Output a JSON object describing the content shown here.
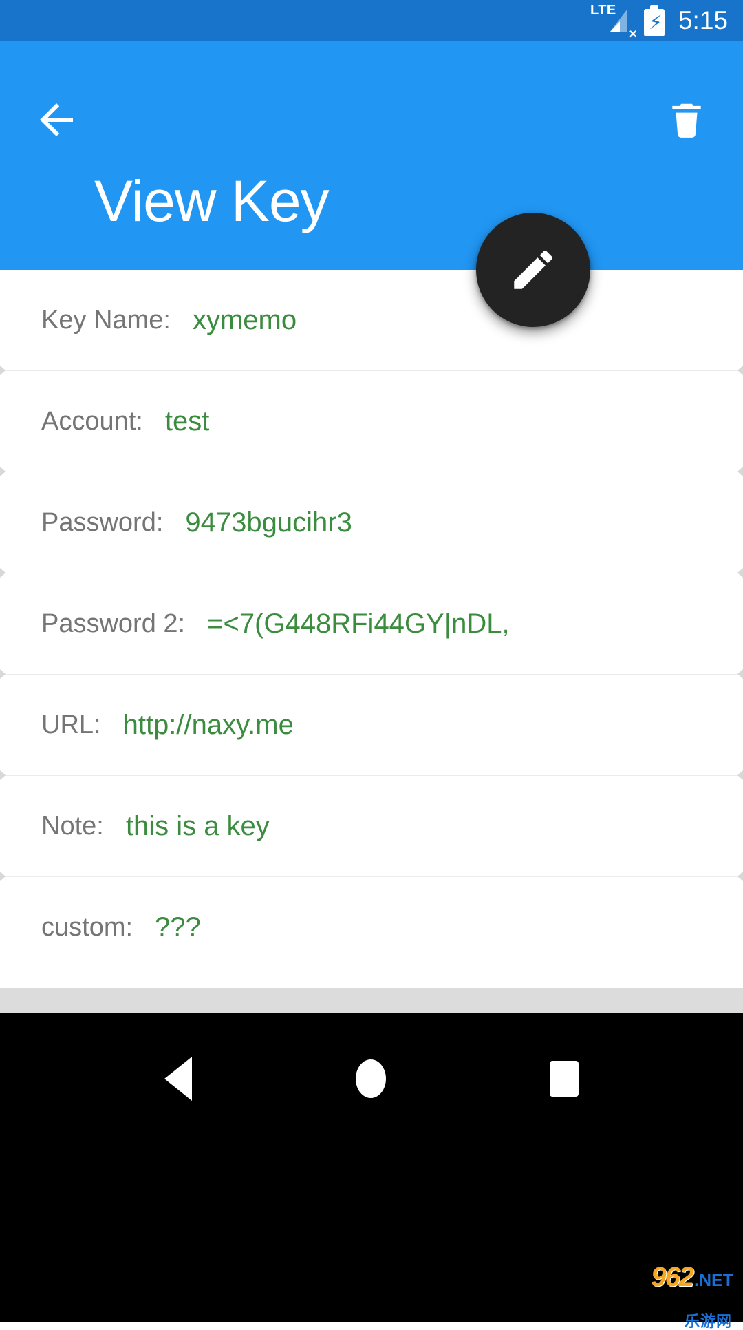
{
  "status_bar": {
    "network_label": "LTE",
    "no_signal_mark": "×",
    "battery_icon": "battery-charging-icon",
    "time": "5:15"
  },
  "app_bar": {
    "title": "View Key",
    "back_icon": "arrow-left-icon",
    "delete_icon": "trash-icon",
    "background_color": "#2196F3"
  },
  "fab": {
    "icon": "pencil-edit-icon",
    "background_color": "#232323",
    "icon_color": "#FFFFFF"
  },
  "colors": {
    "label": "#757575",
    "value": "#3B8C3F",
    "accent": "#2196F3",
    "status_bar": "#1874CB"
  },
  "fields": [
    {
      "label": "Key Name:",
      "value": "xymemo"
    },
    {
      "label": "Account:",
      "value": "test"
    },
    {
      "label": "Password:",
      "value": "9473bgucihr3"
    },
    {
      "label": "Password 2:",
      "value": "=<7(G448RFi44GY|nDL,"
    },
    {
      "label": "URL:",
      "value": "http://naxy.me"
    },
    {
      "label": "Note:",
      "value": "this is a key"
    },
    {
      "label": "custom:",
      "value": "???"
    }
  ],
  "nav_bar": {
    "back": "nav-back-triangle-icon",
    "home": "nav-home-circle-icon",
    "recents": "nav-recents-square-icon"
  },
  "watermark": {
    "number": "962",
    "suffix": ".NET",
    "chinese": "乐游网"
  }
}
